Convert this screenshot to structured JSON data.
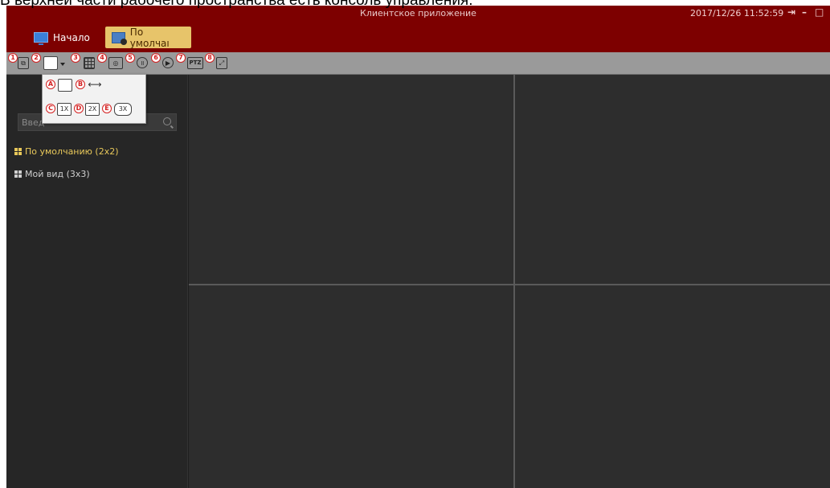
{
  "caption": "В верхней части рабочего пространства есть консоль управления:",
  "window": {
    "title": "Клиентское приложение",
    "datetime": "2017/12/26 11:52:59",
    "controls": [
      "⇥",
      "–",
      "□"
    ]
  },
  "nav": {
    "home_label": "Начало",
    "default_label": "По умолчаı"
  },
  "toolbar": {
    "markers": [
      "1",
      "2",
      "3",
      "4",
      "5",
      "6",
      "7",
      "8"
    ],
    "ptz_label": "PTZ"
  },
  "popup": {
    "markers": [
      "A",
      "B",
      "C",
      "D",
      "E"
    ],
    "buttons": [
      "1X",
      "2X",
      "3X"
    ]
  },
  "sidebar": {
    "search_placeholder": "Введ",
    "views": [
      {
        "label": "По умолчанию (2x2)",
        "active": true
      },
      {
        "label": "Мой вид (3x3)",
        "active": false
      }
    ]
  },
  "colors": {
    "title_bar": "#7d0000",
    "active_tab": "#e7c46a",
    "active_view_text": "#e8c85a",
    "marker": "#d42020"
  }
}
